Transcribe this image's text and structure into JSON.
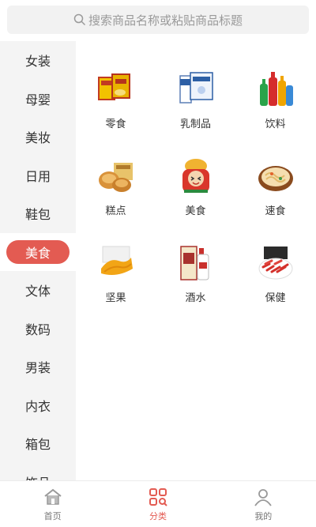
{
  "search": {
    "placeholder": "搜索商品名称或粘贴商品标题"
  },
  "sidebar": {
    "items": [
      {
        "label": "女装"
      },
      {
        "label": "母婴"
      },
      {
        "label": "美妆"
      },
      {
        "label": "日用"
      },
      {
        "label": "鞋包"
      },
      {
        "label": "美食"
      },
      {
        "label": "文体"
      },
      {
        "label": "数码"
      },
      {
        "label": "男装"
      },
      {
        "label": "内衣"
      },
      {
        "label": "箱包"
      },
      {
        "label": "饰品"
      }
    ],
    "active_index": 5
  },
  "categories": [
    {
      "label": "零食"
    },
    {
      "label": "乳制品"
    },
    {
      "label": "饮料"
    },
    {
      "label": "糕点"
    },
    {
      "label": "美食"
    },
    {
      "label": "速食"
    },
    {
      "label": "坚果"
    },
    {
      "label": "酒水"
    },
    {
      "label": "保健"
    }
  ],
  "tabbar": {
    "items": [
      {
        "label": "首页",
        "icon": "home-icon"
      },
      {
        "label": "分类",
        "icon": "category-grid-icon"
      },
      {
        "label": "我的",
        "icon": "user-icon"
      }
    ],
    "active_index": 1
  },
  "colors": {
    "accent": "#e35b52",
    "sidebar_bg": "#f4f4f4",
    "search_bg": "#f2f2f2"
  }
}
